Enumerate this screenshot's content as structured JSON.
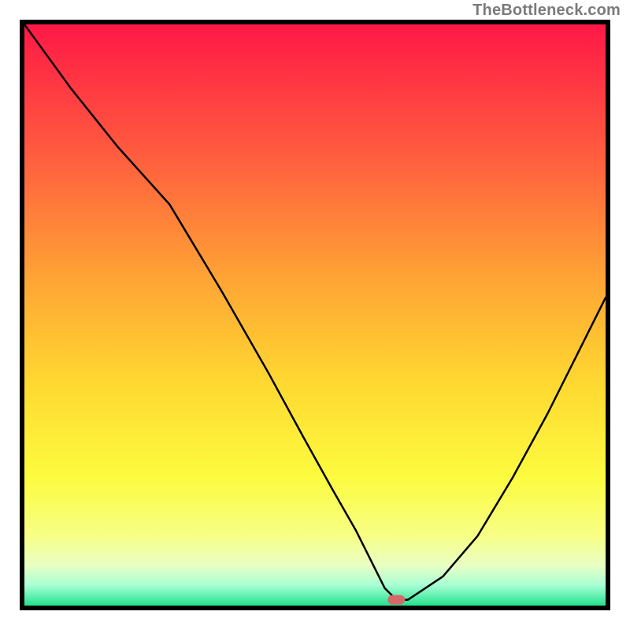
{
  "attribution": "TheBottleneck.com",
  "chart_data": {
    "type": "line",
    "title": "",
    "xlabel": "",
    "ylabel": "",
    "xlim": [
      0,
      100
    ],
    "ylim": [
      0,
      100
    ],
    "x": [
      0,
      8,
      16,
      25,
      34,
      42,
      48,
      53,
      57,
      60,
      62,
      64,
      66,
      72,
      78,
      84,
      90,
      96,
      100
    ],
    "values": [
      100,
      89,
      79,
      69,
      54,
      40,
      29,
      20,
      13,
      7,
      3,
      1,
      1,
      5,
      12,
      22,
      33,
      45,
      53
    ],
    "marker": {
      "x": 64,
      "y": 1,
      "color": "#d66a6a"
    },
    "background_gradient": {
      "stops": [
        {
          "offset": 0.0,
          "color": "#ff1846"
        },
        {
          "offset": 0.22,
          "color": "#ff5b3f"
        },
        {
          "offset": 0.45,
          "color": "#ffa834"
        },
        {
          "offset": 0.62,
          "color": "#ffd931"
        },
        {
          "offset": 0.78,
          "color": "#fcfb3f"
        },
        {
          "offset": 0.88,
          "color": "#f7ff86"
        },
        {
          "offset": 0.93,
          "color": "#eaffc3"
        },
        {
          "offset": 0.965,
          "color": "#a8ffd5"
        },
        {
          "offset": 1.0,
          "color": "#24e28d"
        }
      ]
    }
  }
}
